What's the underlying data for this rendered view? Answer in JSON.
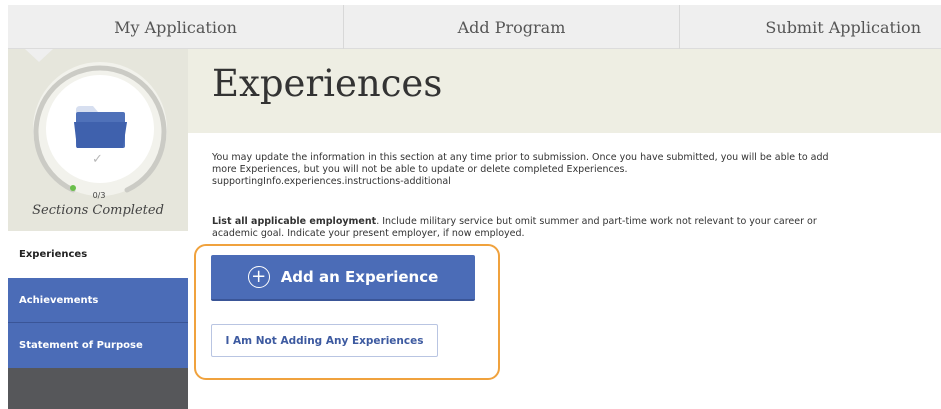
{
  "nav": {
    "tabs": [
      {
        "label": "My Application"
      },
      {
        "label": "Add Program"
      },
      {
        "label": "Submit Application"
      }
    ]
  },
  "progress": {
    "completed": 0,
    "total": 3,
    "count_text": "0/3",
    "label": "Sections Completed",
    "icon": "folder-icon"
  },
  "sidebar": {
    "items": [
      {
        "label": "Experiences",
        "active": true
      },
      {
        "label": "Achievements",
        "active": false
      },
      {
        "label": "Statement of Purpose",
        "active": false
      }
    ]
  },
  "main": {
    "title": "Experiences",
    "instructions_line1": "You may update the information in this section at any time prior to submission. Once you have submitted, you will be able to add more Experiences, but you will not be able to update or delete completed Experiences.",
    "instructions_line2": "supportingInfo.experiences.instructions-additional",
    "list_bold": "List all applicable employment",
    "list_text": ". Include military service but omit summer and part-time work not relevant to your career or academic goal. Indicate your present employer, if now employed.",
    "add_button": "Add an Experience",
    "none_button": "I Am Not Adding Any Experiences"
  },
  "colors": {
    "primary": "#4b6cb7",
    "highlight": "#f0a23d",
    "band": "#eeeee3",
    "sidebar_dark": "#56575a"
  }
}
